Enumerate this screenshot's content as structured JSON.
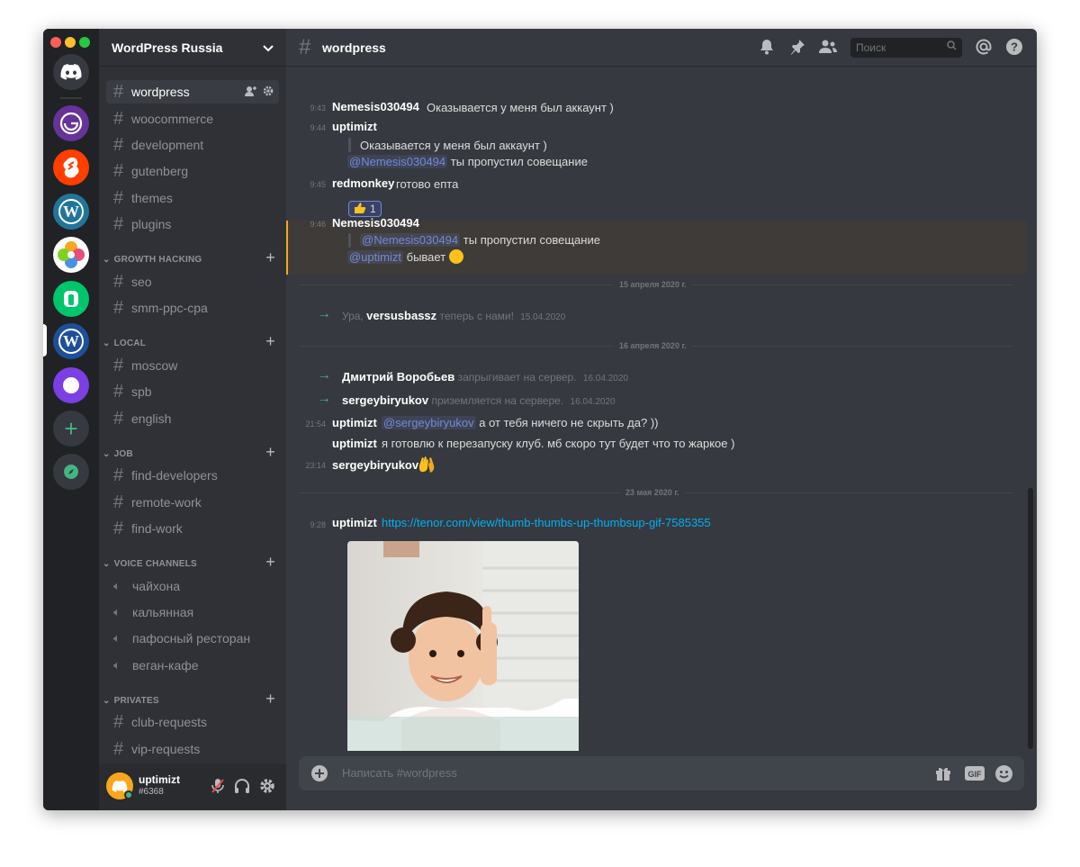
{
  "server_name": "WordPress Russia",
  "rail": {
    "servers": [
      "discord-home",
      "gatsby",
      "svelte",
      "wordpress",
      "colorful-logo",
      "green-logo",
      "wordpress-russia",
      "purple-circle"
    ],
    "add_label": "+",
    "explore_icon": "compass-icon"
  },
  "channels": {
    "top": [
      {
        "name": "wordpress",
        "active": true
      },
      {
        "name": "woocommerce"
      },
      {
        "name": "development"
      },
      {
        "name": "gutenberg"
      },
      {
        "name": "themes"
      },
      {
        "name": "plugins"
      }
    ],
    "categories": [
      {
        "title": "GROWTH HACKING",
        "items": [
          "seo",
          "smm-ppc-cpa"
        ]
      },
      {
        "title": "LOCAL",
        "items": [
          "moscow",
          "spb",
          "english"
        ]
      },
      {
        "title": "JOB",
        "items": [
          "find-developers",
          "remote-work",
          "find-work"
        ]
      },
      {
        "title": "VOICE CHANNELS",
        "items": [
          "чайхона",
          "кальянная",
          "пафосный ресторан",
          "веган-кафе"
        ]
      },
      {
        "title": "PRIVATES",
        "items": [
          "club-requests",
          "vip-requests"
        ]
      }
    ]
  },
  "user": {
    "name": "uptimizt",
    "tag": "#6368"
  },
  "topbar": {
    "channel": "wordpress",
    "search_placeholder": "Поиск"
  },
  "messages": {
    "m1": {
      "time": "9:43",
      "author": "Nemesis030494",
      "text": "Оказывается у меня был аккаунт )"
    },
    "m2": {
      "time": "9:44",
      "author": "uptimizt",
      "quote": "Оказывается у меня был аккаунт )",
      "mention": "@Nemesis030494",
      "text": "ты пропустил совещание"
    },
    "m3": {
      "time": "9:45",
      "author": "redmonkey",
      "text": "готово епта",
      "reaction_count": "1"
    },
    "m4": {
      "time": "9:46",
      "author": "Nemesis030494",
      "quote_mention": "@Nemesis030494",
      "quote": "ты пропустил совещание",
      "mention": "@uptimizt",
      "text": "бывает"
    },
    "d1": "15 апреля 2020 г.",
    "s1": {
      "pre": "Ура,",
      "user": "versusbassz",
      "post": "теперь с нами!",
      "date": "15.04.2020"
    },
    "d2": "16 апреля 2020 г.",
    "s2": {
      "user": "Дмитрий Воробьев",
      "post": "запрыгивает на сервер.",
      "date": "16.04.2020"
    },
    "s3": {
      "user": "sergeybiryukov",
      "post": "приземляется на сервере.",
      "date": "16.04.2020"
    },
    "m5": {
      "time": "21:54",
      "author": "uptimizt",
      "mention": "@sergeybiryukov",
      "text": "а от тебя ничего не скрыть да? ))"
    },
    "m6": {
      "author": "uptimizt",
      "text": "я готовлю к перезапуску клуб. мб скоро тут будет что то жаркое )"
    },
    "m7": {
      "time": "23:14",
      "author": "sergeybiryukov"
    },
    "d3": "23 мая 2020 г.",
    "m8": {
      "time": "9:28",
      "author": "uptimizt",
      "link": "https://tenor.com/view/thumb-thumbs-up-thumbsup-gif-7585355"
    }
  },
  "composer": {
    "placeholder": "Написать #wordpress"
  },
  "colors": {
    "accent": "#7289da",
    "online": "#43b581",
    "link": "#00b0f4",
    "highlight_border": "#faa61a"
  }
}
